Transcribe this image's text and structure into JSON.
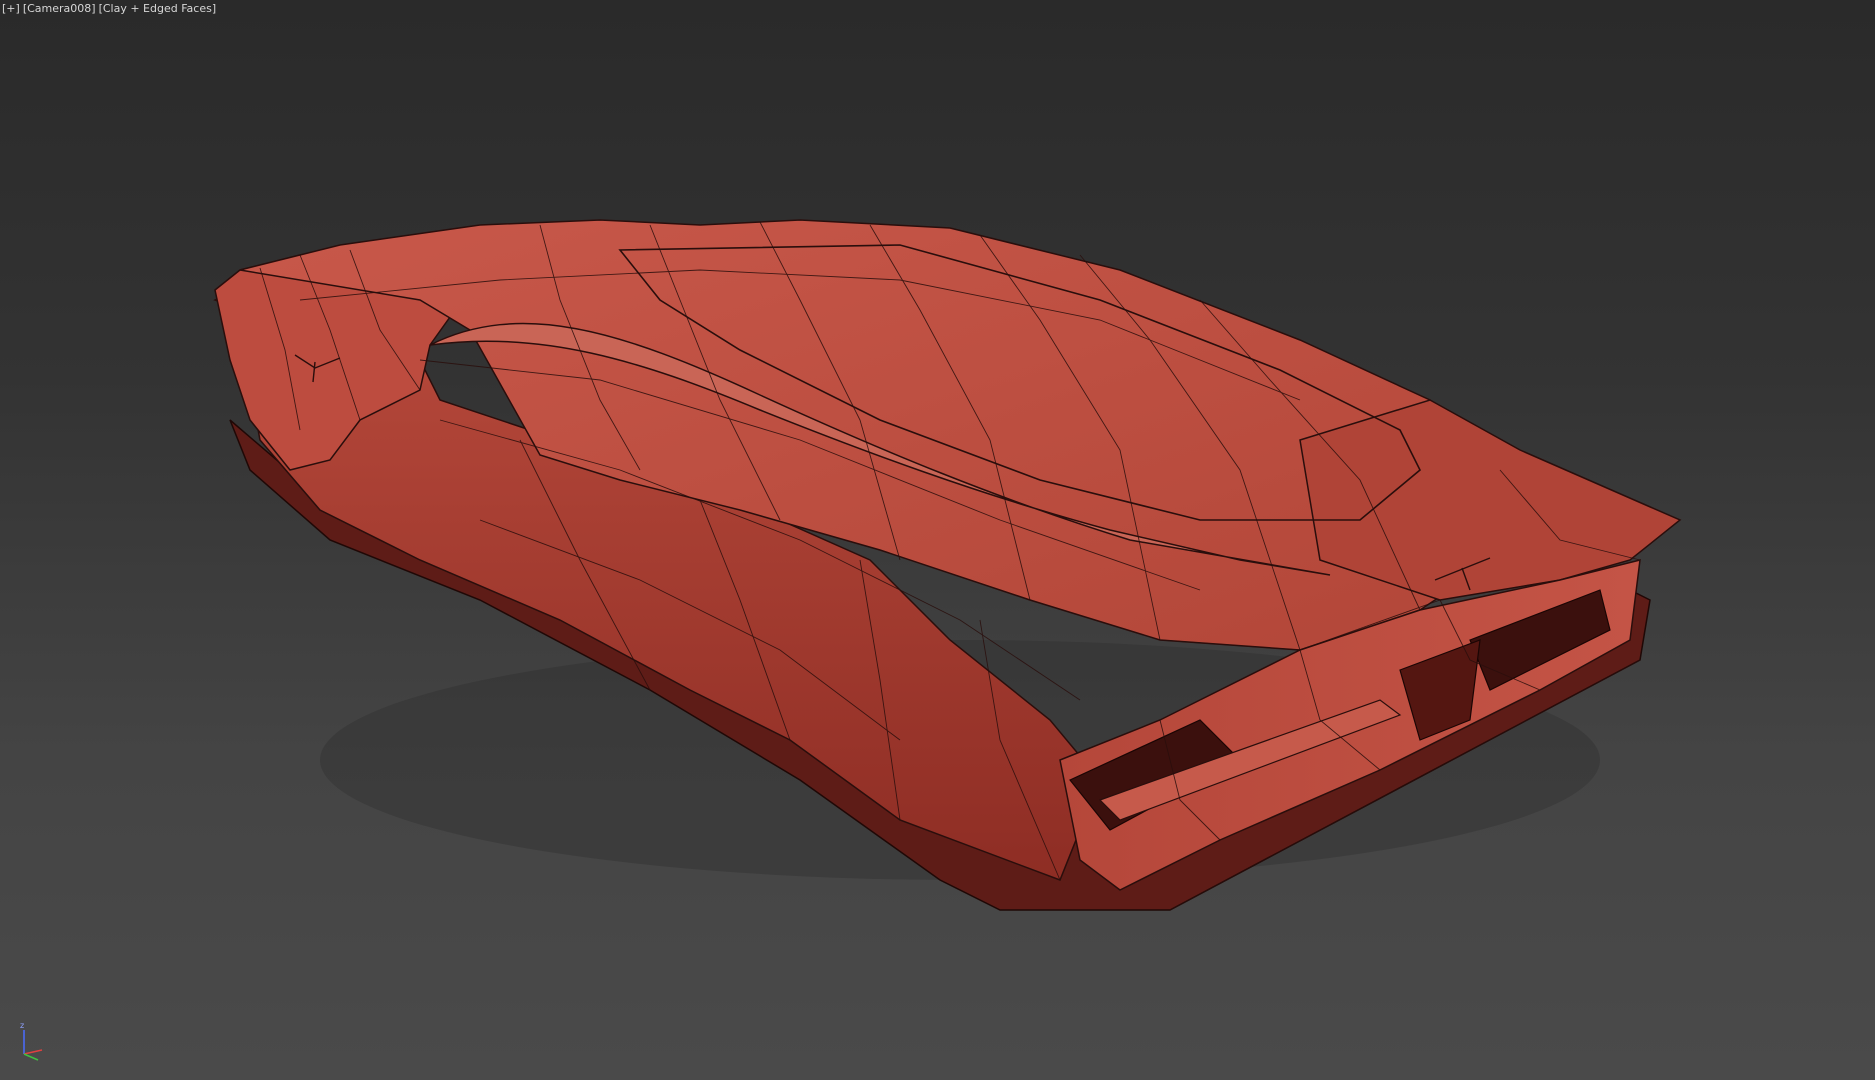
{
  "viewport": {
    "label": {
      "plus": "[+]",
      "camera": "[Camera008]",
      "shading": "[Clay + Edged Faces]"
    },
    "colors": {
      "background_top": "#2a2a2a",
      "background_bottom": "#4a4a4a",
      "clay": "#b84a3e",
      "clay_dark": "#7a2520",
      "edge": "#2a0e0c"
    },
    "gizmo": {
      "axis_z": "z"
    }
  }
}
